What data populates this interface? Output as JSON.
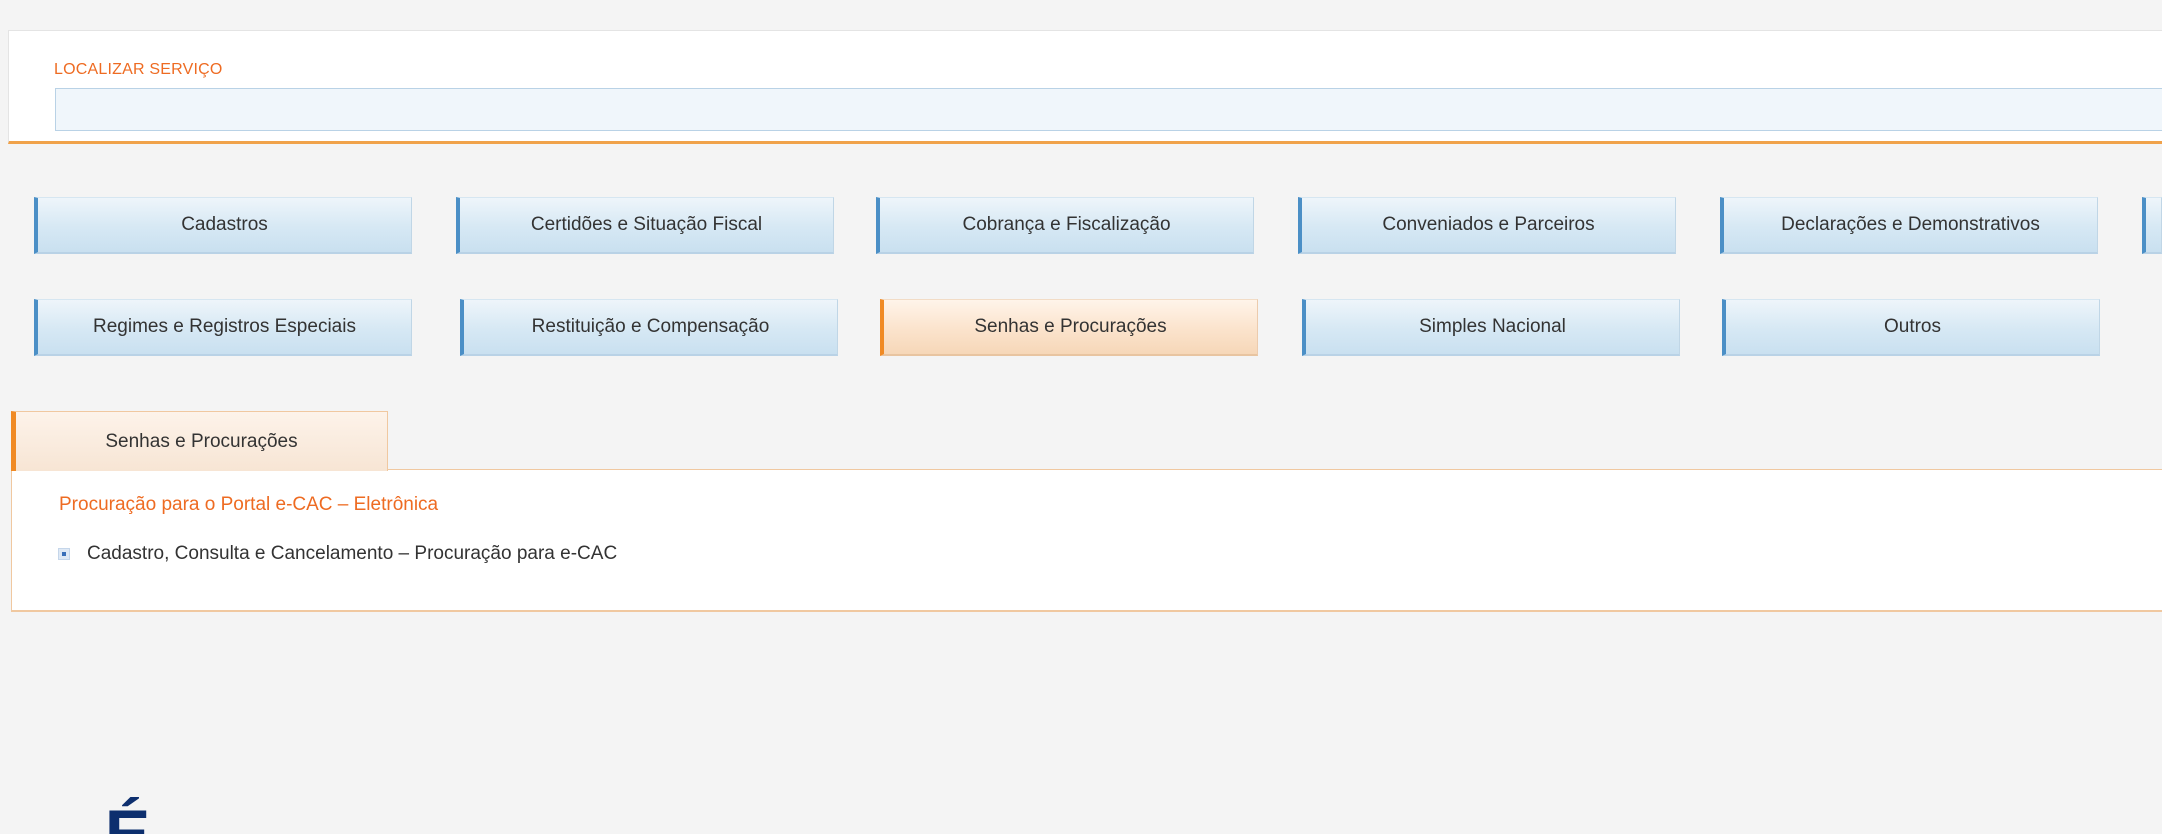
{
  "search": {
    "label": "LOCALIZAR SERVIÇO",
    "placeholder": "",
    "value": ""
  },
  "categories": {
    "row1": [
      {
        "label": "Cadastros",
        "active": false
      },
      {
        "label": "Certidões e Situação Fiscal",
        "active": false
      },
      {
        "label": "Cobrança e Fiscalização",
        "active": false
      },
      {
        "label": "Conveniados e Parceiros",
        "active": false
      },
      {
        "label": "Declarações e Demonstrativos",
        "active": false
      },
      {
        "label": "",
        "active": false
      }
    ],
    "row2": [
      {
        "label": "Regimes e Registros Especiais",
        "active": false
      },
      {
        "label": "Restituição e Compensação",
        "active": false
      },
      {
        "label": "Senhas e Procurações",
        "active": true
      },
      {
        "label": "Simples Nacional",
        "active": false
      },
      {
        "label": "Outros",
        "active": false
      }
    ]
  },
  "tab": {
    "label": "Senhas e Procurações"
  },
  "content": {
    "heading": "Procuração para o Portal e-CAC – Eletrônica",
    "items": [
      {
        "label": "Cadastro, Consulta e Cancelamento – Procuração para e-CAC",
        "icon": "bullet-square-icon"
      }
    ]
  },
  "bottom_text": "— É",
  "colors": {
    "accent_orange": "#ee6b22",
    "border_orange": "#f0a24a",
    "button_blue_edge": "#4b8fc6",
    "active_orange_edge": "#f08a24"
  }
}
